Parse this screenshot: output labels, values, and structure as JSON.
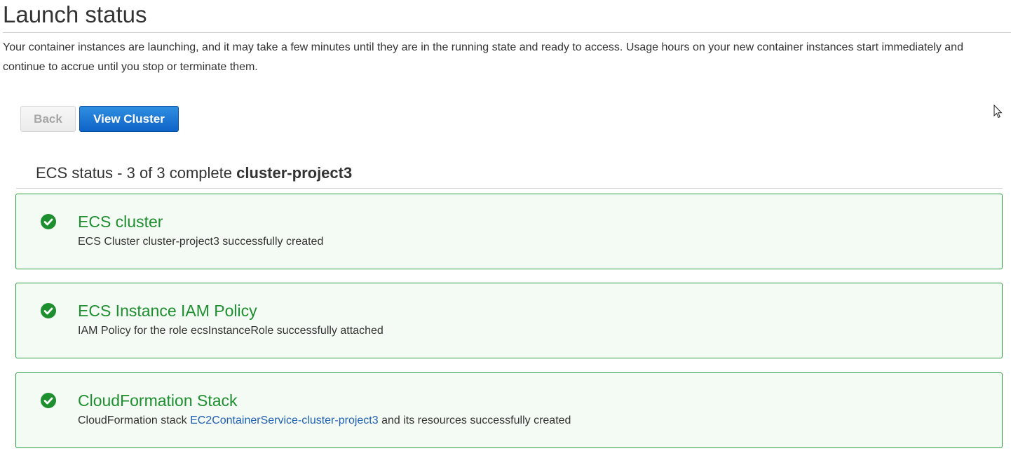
{
  "page": {
    "title": "Launch status",
    "intro": "Your container instances are launching, and it may take a few minutes until they are in the running state and ready to access. Usage hours on your new container instances start immediately and continue to accrue until you stop or terminate them."
  },
  "buttons": {
    "back_label": "Back",
    "view_cluster_label": "View Cluster"
  },
  "ecs_status": {
    "heading": "ECS status - 3 of 3 complete",
    "cluster_name": "cluster-project3"
  },
  "status_items": [
    {
      "title": "ECS cluster",
      "description": "ECS Cluster cluster-project3 successfully created",
      "icon": "check-circle-icon"
    },
    {
      "title": "ECS Instance IAM Policy",
      "description": "IAM Policy for the role ecsInstanceRole successfully attached",
      "icon": "check-circle-icon"
    },
    {
      "title": "CloudFormation Stack",
      "description_prefix": "CloudFormation stack",
      "link_text": "EC2ContainerService-cluster-project3",
      "description_suffix": "and its resources successfully created",
      "icon": "check-circle-icon"
    }
  ],
  "colors": {
    "success": "#1d8f2f",
    "success_bg": "#f4fbf4",
    "primary_button": "#1a73d4",
    "link": "#1f5fb4"
  }
}
